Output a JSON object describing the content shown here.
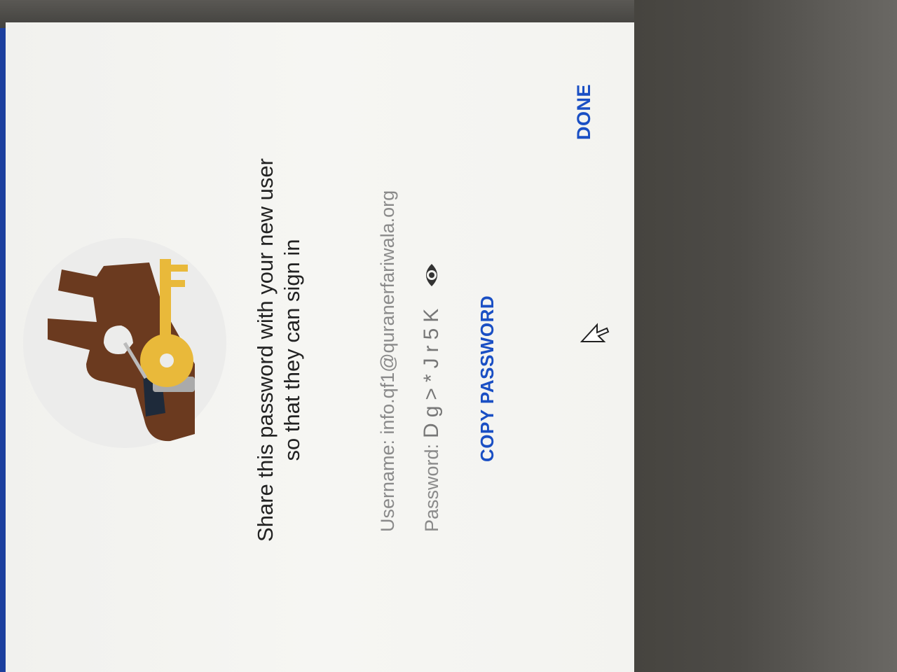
{
  "dialog": {
    "message_line1": "Share this password with your new user",
    "message_line2": "so that they can sign in",
    "username_label": "Username:",
    "username_value": "info.qf1@quranerfariwala.org",
    "password_label": "Password:",
    "password_value": "Dg>*Jr5K",
    "copy_password_label": "COPY PASSWORD",
    "done_label": "DONE"
  },
  "icons": {
    "illustration": "hand-holding-key-illustration",
    "show_password": "eye-icon",
    "cursor": "mouse-pointer-icon"
  },
  "colors": {
    "accent": "#1a4fc4",
    "key": "#e9b93a",
    "hand": "#6b3a1f",
    "cuff": "#1e2a3a"
  }
}
